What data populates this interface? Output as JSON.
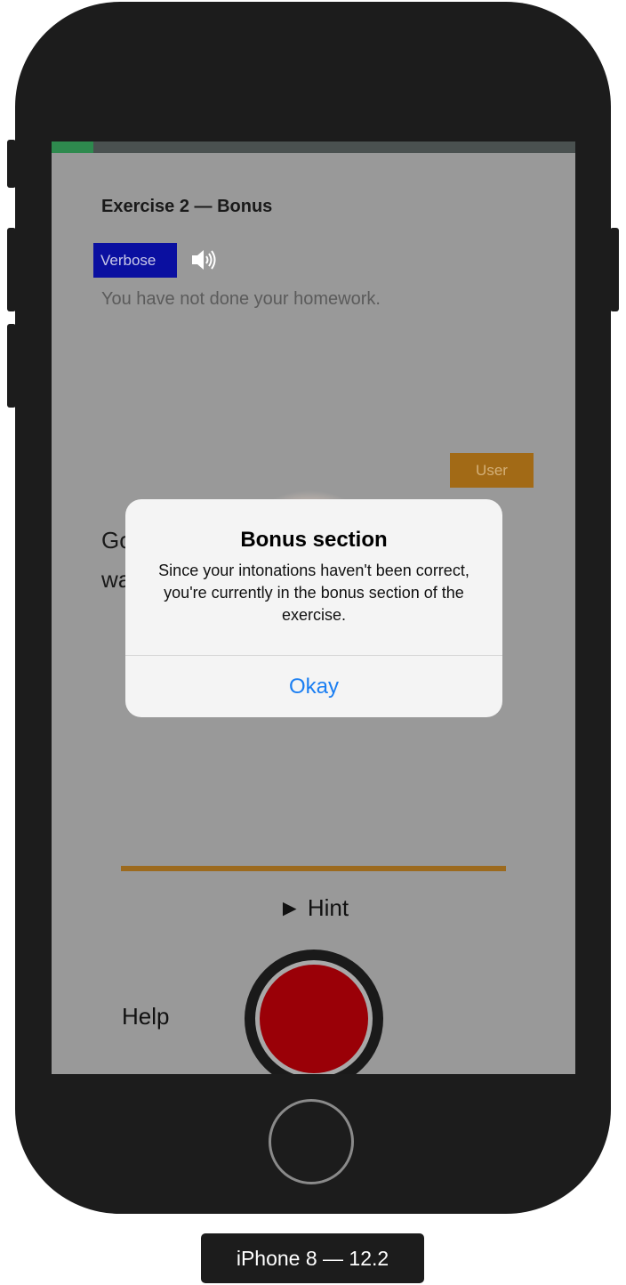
{
  "exercise": {
    "title": "Exercise 2 — Bonus",
    "progress": 0.08
  },
  "prompt": {
    "verbose_label": "Verbose",
    "speaker_icon": "speaker-icon",
    "sentence": "You have not done your homework."
  },
  "user": {
    "label": "User",
    "response_text": "Go\nwa"
  },
  "controls": {
    "hint_label": "► Hint",
    "help_label": "Help",
    "record_icon": "record-icon"
  },
  "alert": {
    "title": "Bonus section",
    "message": "Since your intonations haven't been correct, you're currently in the bonus section of the exercise.",
    "button_label": "Okay"
  },
  "device": {
    "label": "iPhone 8 — 12.2"
  },
  "colors": {
    "verbose_bg": "#0a0fa0",
    "user_bg": "#a26a16",
    "record": "#9a0007",
    "progress": "#2e8a4e",
    "alert_button": "#1a7ef2"
  }
}
